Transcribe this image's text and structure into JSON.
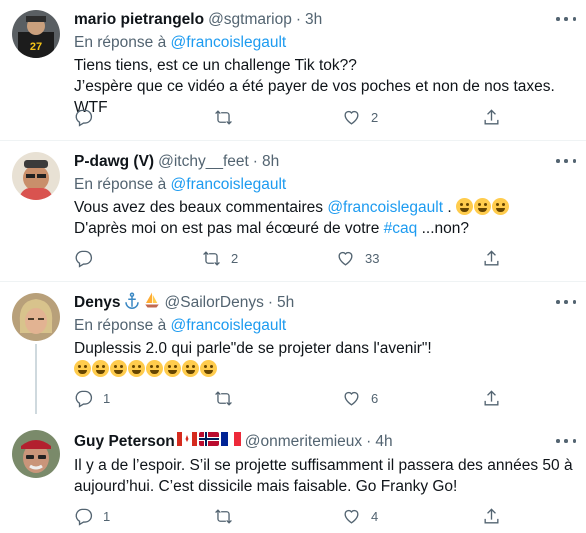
{
  "colors": {
    "link": "#1d9bf0",
    "secondary": "#536471",
    "text": "#0f1419",
    "divider": "#eff3f4"
  },
  "tweets": [
    {
      "name": "mario pietrangelo",
      "handle": "@sgtmariop",
      "separator": "·",
      "time": "3h",
      "reply_prefix": "En réponse à",
      "reply_mention": "@francoislegault",
      "line1": "Tiens tiens, est ce un challenge Tik tok??",
      "line2": "J’espère que ce vidéo a été payer de vos poches et non de nos taxes. WTF",
      "actions": {
        "reply": "",
        "retweet": "",
        "like": "2"
      }
    },
    {
      "name": "P-dawg (V)",
      "handle": "@itchy__feet",
      "separator": "·",
      "time": "8h",
      "reply_prefix": "En réponse à",
      "reply_mention": "@francoislegault",
      "line1_pre": "Vous avez des beaux commentaires",
      "line1_mention": "@francoislegault",
      "line1_post": ".",
      "line1_emojis": [
        "rolling-on-floor-laughing",
        "rolling-on-floor-laughing",
        "rolling-on-floor-laughing"
      ],
      "line2_pre": "D'après moi on est pas mal écœuré de votre",
      "line2_hashtag": "#caq",
      "line2_post": "...non?",
      "actions": {
        "reply": "",
        "retweet": "2",
        "like": "33"
      }
    },
    {
      "name": "Denys",
      "name_emojis": [
        "anchor",
        "sailboat"
      ],
      "handle": "@SailorDenys",
      "separator": "·",
      "time": "5h",
      "reply_prefix": "En réponse à",
      "reply_mention": "@francoislegault",
      "line1": "Duplessis 2.0 qui parle\"de se projeter dans l'avenir\"!",
      "line2_emojis": [
        "grinning-squinting",
        "rolling-on-floor-laughing",
        "zany-face",
        "winking-tongue",
        "grinning-squinting",
        "rolling-on-floor-laughing",
        "zany-face",
        "winking-tongue"
      ],
      "actions": {
        "reply": "1",
        "retweet": "",
        "like": "6"
      }
    },
    {
      "name": "Guy Peterson",
      "name_emojis": [
        "flag-canada",
        "flag-norway",
        "flag-france"
      ],
      "handle": "@onmeritemieux",
      "separator": "·",
      "time": "4h",
      "line1": "Il y a de l’espoir. S’il se projette suffisamment il passera des années 50 à",
      "line2": "aujourd’hui. C’est dissicile mais faisable.  Go Franky Go!",
      "actions": {
        "reply": "1",
        "retweet": "",
        "like": "4"
      }
    }
  ]
}
